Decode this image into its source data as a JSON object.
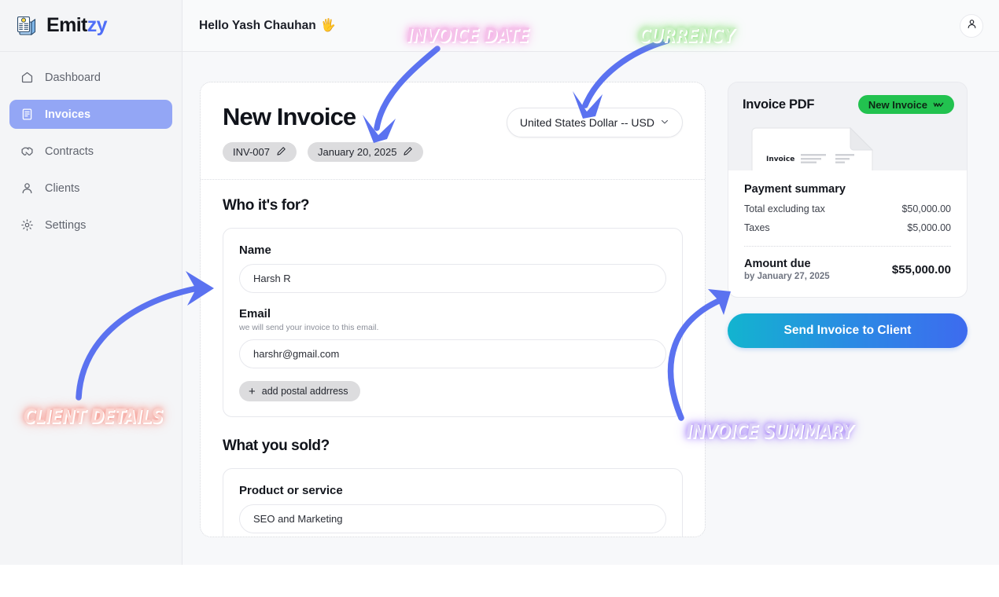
{
  "brand": {
    "name_main": "Emit",
    "name_accent": "zy",
    "logo_icon": "invoice-documents-icon"
  },
  "sidebar": {
    "items": [
      {
        "label": "Dashboard",
        "icon": "home-icon",
        "active": false
      },
      {
        "label": "Invoices",
        "icon": "file-text-icon",
        "active": true
      },
      {
        "label": "Contracts",
        "icon": "handshake-icon",
        "active": false
      },
      {
        "label": "Clients",
        "icon": "person-icon",
        "active": false
      },
      {
        "label": "Settings",
        "icon": "gear-icon",
        "active": false
      }
    ]
  },
  "topbar": {
    "greeting": "Hello Yash Chauhan",
    "greeting_emoji": "🖐️",
    "avatar_icon": "user-avatar-icon"
  },
  "invoice": {
    "title": "New Invoice",
    "number_chip": "INV-007",
    "date_chip": "January 20, 2025",
    "edit_icon": "pencil-icon",
    "currency": "United States Dollar -- USD",
    "currency_caret_icon": "chevron-down-icon"
  },
  "who_section": {
    "heading": "Who it's for?",
    "name_label": "Name",
    "name_value": "Harsh R",
    "email_label": "Email",
    "email_hint": "we will send your invoice to this email.",
    "email_value": "harshr@gmail.com",
    "add_address_label": "add postal addrress",
    "add_icon": "plus-icon"
  },
  "sold_section": {
    "heading": "What you sold?",
    "product_label": "Product or service",
    "product_value": "SEO and Marketing"
  },
  "pdf_panel": {
    "title": "Invoice PDF",
    "badge_label": "New Invoice",
    "badge_icon": "chevron-squiggle-icon",
    "thumb_title": "Invoice",
    "summary_title": "Payment summary",
    "rows": [
      {
        "label": "Total excluding tax",
        "value": "$50,000.00"
      },
      {
        "label": "Taxes",
        "value": "$5,000.00"
      }
    ],
    "due_label": "Amount due",
    "due_sub": "by January 27, 2025",
    "due_value": "$55,000.00",
    "send_button": "Send Invoice to Client"
  },
  "annotations": {
    "invoice_date": "INVOICE DATE",
    "currency": "CURRENCY",
    "client_details": "CLIENT DETAILS",
    "invoice_summary": "INVOICE SUMMARY"
  },
  "colors": {
    "sidebar_active": "#93a6f5",
    "brand_accent": "#4f6ef7",
    "badge_green": "#22c24f",
    "arrow_blue": "#5b72f0",
    "send_gradient_start": "#12b4cf",
    "send_gradient_end": "#3d6bef"
  }
}
